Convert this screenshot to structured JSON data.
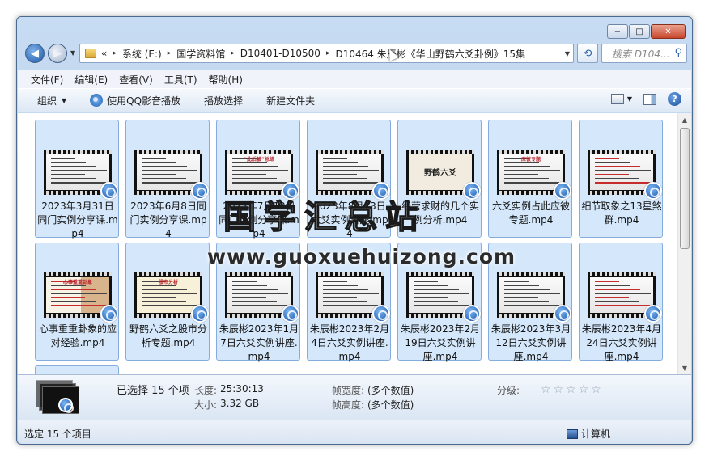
{
  "window": {
    "minimize": "−",
    "maximize": "□",
    "close": "✕"
  },
  "nav": {
    "address_parts": [
      "«",
      "系统 (E:)",
      "国学资料馆",
      "D10401-D10500",
      "D10464 朱辰彬《华山野鹤六爻卦例》15集"
    ],
    "search_placeholder": "搜索 D104...",
    "separator": "▸"
  },
  "menu": [
    "文件(F)",
    "编辑(E)",
    "查看(V)",
    "工具(T)",
    "帮助(H)"
  ],
  "toolbar": {
    "organize": "组织",
    "qq_player": "使用QQ影音播放",
    "play_selection": "播放选择",
    "new_folder": "新建文件夹"
  },
  "files": [
    {
      "name": "2023年3月31日同门实例分享课.mp4",
      "thumb": "table"
    },
    {
      "name": "2023年6月8日同门实例分享课.mp4",
      "thumb": "table"
    },
    {
      "name": "2023年7月12日同门实例分享课.mp4",
      "thumb": "text",
      "thumb_title": "“此后被”总结"
    },
    {
      "name": "2023年8月13日六爻实例讲座.mp4",
      "thumb": "table"
    },
    {
      "name": "经营求财的几个实例分析.mp4",
      "thumb": "title",
      "thumb_title": "野鹤六爻"
    },
    {
      "name": "六爻实例占此应彼专题.mp4",
      "thumb": "colortable",
      "thumb_title": "应彼专题"
    },
    {
      "name": "细节取象之13星煞群.mp4",
      "thumb": "redtable"
    },
    {
      "name": "心事重重卦象的应对经验.mp4",
      "thumb": "person",
      "thumb_title": "心事重重卦象"
    },
    {
      "name": "野鹤六爻之股市分析专题.mp4",
      "thumb": "list",
      "thumb_title": "股市分析"
    },
    {
      "name": "朱辰彬2023年1月7日六爻实例讲座.mp4",
      "thumb": "table"
    },
    {
      "name": "朱辰彬2023年2月4日六爻实例讲座.mp4",
      "thumb": "table"
    },
    {
      "name": "朱辰彬2023年2月19日六爻实例讲座.mp4",
      "thumb": "table"
    },
    {
      "name": "朱辰彬2023年3月12日六爻实例讲座.mp4",
      "thumb": "table"
    },
    {
      "name": "朱辰彬2023年4月24日六爻实例讲座.mp4",
      "thumb": "redtable"
    },
    {
      "name": "",
      "thumb": "partial"
    }
  ],
  "details": {
    "selected": "已选择 15 个项",
    "duration_label": "长度:",
    "duration": "25:30:13",
    "size_label": "大小:",
    "size": "3.32 GB",
    "width_label": "帧宽度:",
    "width": "(多个数值)",
    "height_label": "帧高度:",
    "height": "(多个数值)",
    "rating_label": "分级:",
    "rating_stars": 0
  },
  "status": {
    "left": "选定 15 个项目",
    "right": "计算机"
  },
  "watermark": {
    "cn": "国学汇总站",
    "url": "www.guoxuehuizong.com"
  },
  "colors": {
    "accent": "#1f5fb0",
    "tile_bg": "#d5e8fb",
    "tile_border": "#84acdd"
  }
}
